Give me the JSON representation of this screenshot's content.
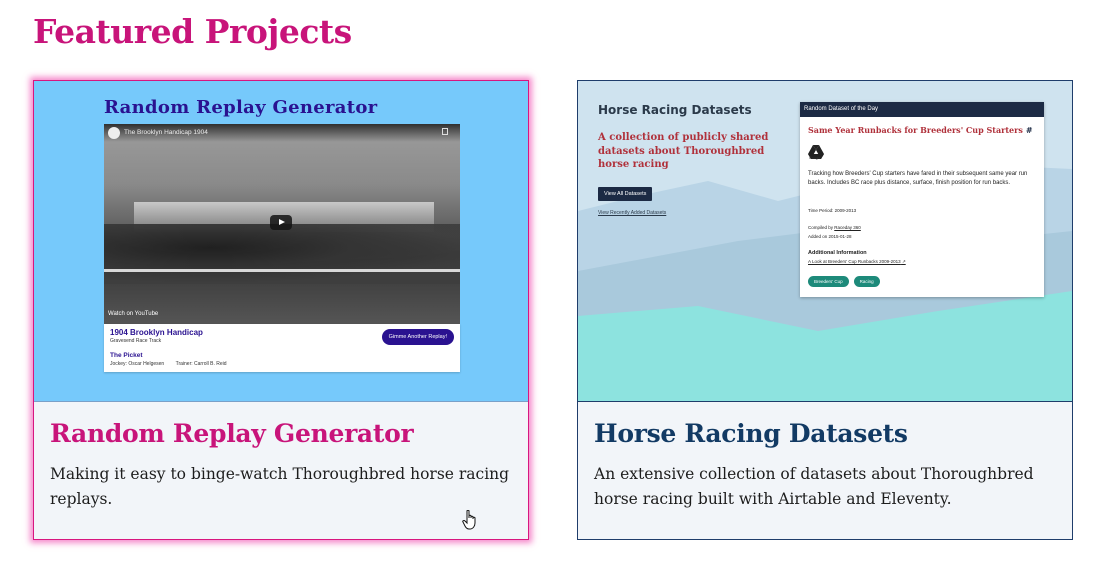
{
  "section": {
    "title": "Featured Projects"
  },
  "cards": [
    {
      "title": "Random Replay Generator",
      "description": "Making it easy to binge-watch Thoroughbred horse racing replays.",
      "thumbnail": {
        "heading": "Random Replay Generator",
        "video_title": "The Brooklyn Handicap 1904",
        "watch_on": "Watch on  YouTube",
        "race_name": "1904 Brooklyn Handicap",
        "track": "Gravesend Race Track",
        "horse": "The Picket",
        "jockey": "Jockey: Oscar Helgesen",
        "trainer": "Trainer: Carroll B. Reid",
        "button": "Gimme Another Replay!"
      }
    },
    {
      "title": "Horse Racing Datasets",
      "description": "An extensive collection of datasets about Thoroughbred horse racing built with Airtable and Eleventy.",
      "thumbnail": {
        "heading": "Horse Racing Datasets",
        "tagline": "A collection of publicly shared datasets about Thoroughbred horse racing",
        "button": "View All Datasets",
        "link": "View Recently Added Datasets",
        "panel_header": "Random Dataset of the Day",
        "dataset_title": "Same Year Runbacks for Breeders' Cup Starters",
        "hash": "#",
        "source_label": "Google",
        "dataset_desc": "Tracking how Breeders' Cup starters have fared in their subsequent same year run backs. Includes BC race plus distance, surface, finish position for run backs.",
        "time_period": "Time Period: 2009-2013",
        "compiled_prefix": "Compiled by ",
        "compiled_by": "Raceday 360",
        "added": "Added on 2015-01-28",
        "additional_info": "Additional Information",
        "info_link": "A Look at Breeders' Cup Runbacks 2009-2013",
        "tags": [
          "Breeders' Cup",
          "Racing"
        ]
      }
    }
  ],
  "colors": {
    "accent_pink": "#c8147a",
    "navy": "#123a64",
    "replay_sky": "#76c9fb",
    "dataset_red": "#b0313b",
    "tag_teal": "#1d8a7a"
  }
}
